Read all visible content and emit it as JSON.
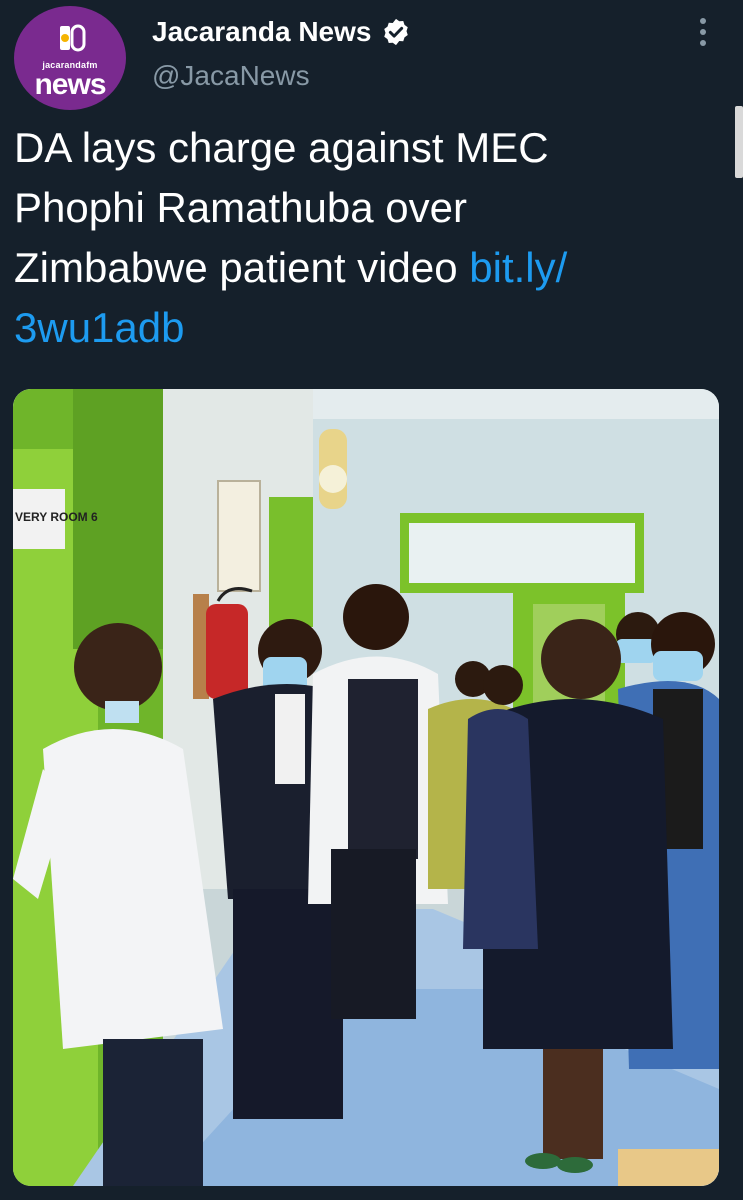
{
  "account": {
    "display_name": "Jacaranda News",
    "handle": "@JacaNews",
    "verified": true,
    "avatar": {
      "small_text": "jacarandafm",
      "big_text": "news",
      "color": "#7a2a8f"
    }
  },
  "tweet": {
    "text_plain": "DA lays charge against MEC Phophi Ramathuba over Zimbabwe patient video",
    "link": "bit.ly/3wu1adb",
    "link_line1": "bit.ly/",
    "link_line2": "3wu1adb",
    "line1": "DA lays charge against MEC",
    "line2": "Phophi Ramathuba over",
    "line3": "Zimbabwe patient video "
  },
  "media": {
    "door_sign": "VERY ROOM 6"
  },
  "icons": {
    "more": "more-vertical-icon",
    "verified": "verified-badge-icon"
  },
  "colors": {
    "background": "#15202b",
    "link": "#1d9bf0",
    "secondary_text": "#8899a6",
    "wall_green": "#7cc22a"
  }
}
